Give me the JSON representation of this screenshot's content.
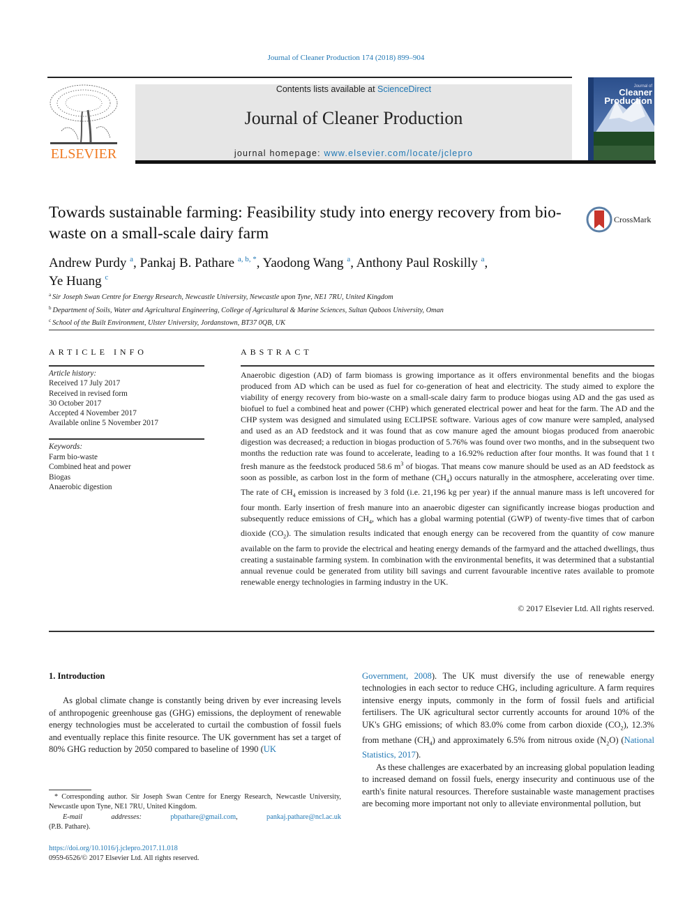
{
  "running_head": "Journal of Cleaner Production 174 (2018) 899–904",
  "publisher": {
    "name": "ELSEVIER",
    "logo_icon": "elsevier-tree-logo",
    "color": "#f07a22"
  },
  "banner": {
    "contents_prefix": "Contents lists available at ",
    "contents_link": "ScienceDirect",
    "journal_title": "Journal of Cleaner Production",
    "homepage_prefix": "journal homepage: ",
    "homepage_link": "www.elsevier.com/locate/jclepro"
  },
  "cover": {
    "line1": "Journal of",
    "line2": "Cleaner",
    "line3": "Production"
  },
  "crossmark": {
    "label": "CrossMark",
    "icon": "crossmark-icon"
  },
  "article": {
    "title": "Towards sustainable farming: Feasibility study into energy recovery from bio-waste on a small-scale dairy farm",
    "authors": [
      {
        "name": "Andrew Purdy",
        "sup": "a",
        "sep": ", "
      },
      {
        "name": "Pankaj B. Pathare",
        "sup": "a, b, *",
        "sep": ", "
      },
      {
        "name": "Yaodong Wang",
        "sup": "a",
        "sep": ", "
      },
      {
        "name": "Anthony Paul Roskilly",
        "sup": "a",
        "sep": ","
      },
      {
        "name": "Ye Huang",
        "sup": "c",
        "sep": ""
      }
    ],
    "affiliations": [
      {
        "key": "a",
        "text": "Sir Joseph Swan Centre for Energy Research, Newcastle University, Newcastle upon Tyne, NE1 7RU, United Kingdom"
      },
      {
        "key": "b",
        "text": "Department of Soils, Water and Agricultural Engineering, College of Agricultural & Marine Sciences, Sultan Qaboos University, Oman"
      },
      {
        "key": "c",
        "text": "School of the Built Environment, Ulster University, Jordanstown, BT37 0QB, UK"
      }
    ]
  },
  "article_info": {
    "heading": "ARTICLE INFO",
    "history_label": "Article history:",
    "history": [
      "Received 17 July 2017",
      "Received in revised form",
      "30 October 2017",
      "Accepted 4 November 2017",
      "Available online 5 November 2017"
    ],
    "keywords_label": "Keywords:",
    "keywords": [
      "Farm bio-waste",
      "Combined heat and power",
      "Biogas",
      "Anaerobic digestion"
    ]
  },
  "abstract": {
    "heading": "ABSTRACT",
    "p1": "Anaerobic digestion (AD) of farm biomass is growing importance as it offers environmental benefits and the biogas produced from AD which can be used as fuel for co-generation of heat and electricity. The study aimed to explore the viability of energy recovery from bio-waste on a small-scale dairy farm to produce biogas using AD and the gas used as biofuel to fuel a combined heat and power (CHP) which generated electrical power and heat for the farm. The AD and the CHP system was designed and simulated using ECLIPSE software. Various ages of cow manure were sampled, analysed and used as an AD feedstock and it was found that as cow manure aged the amount biogas produced from anaerobic digestion was decreased; a reduction in biogas production of 5.76% was found over two months, and in the subsequent two months the reduction rate was found to accelerate, leading to a 16.92% reduction after four months. It was found that 1 t fresh manure as the feedstock produced 58.6 m",
    "p1_sup": "3",
    "p2": " of biogas. That means cow manure should be used as an AD feedstock as soon as possible, as carbon lost in the form of methane (CH",
    "sub_4": "4",
    "sub_2": "2",
    "p3": ") occurs naturally in the atmosphere, accelerating over time. The rate of CH",
    "p4": " emission is increased by 3 fold (i.e. 21,196 kg per year) if the annual manure mass is left uncovered for four month. Early insertion of fresh manure into an anaerobic digester can significantly increase biogas production and subsequently reduce emissions of CH",
    "p5": ", which has a global warming potential (GWP) of twenty-five times that of carbon dioxide (CO",
    "p6": "). The simulation results indicated that enough energy can be recovered from the quantity of cow manure available on the farm to provide the electrical and heating energy demands of the farmyard and the attached dwellings, thus creating a sustainable farming system. In combination with the environmental benefits, it was determined that a substantial annual revenue could be generated from utility bill savings and current favourable incentive rates available to promote renewable energy technologies in farming industry in the UK.",
    "copyright": "© 2017 Elsevier Ltd. All rights reserved."
  },
  "introduction": {
    "heading": "1.  Introduction",
    "left_p1_a": "As global climate change is constantly being driven by ever increasing levels of anthropogenic greenhouse gas (GHG) emissions, the deployment of renewable energy technologies must be accelerated to curtail the combustion of fossil fuels and eventually replace this finite resource. The UK government has set a target of 80% GHG reduction by 2050 compared to baseline of 1990 (",
    "left_cite": "UK",
    "right_cite1": "Government, 2008",
    "right_p1_a": "). The UK must diversify the use of renewable energy technologies in each sector to reduce CHG, including agriculture. A farm requires intensive energy inputs, commonly in the form of fossil fuels and artificial fertilisers. The UK agricultural sector currently accounts for around 10% of the UK's GHG emissions; of which 83.0% come from carbon dioxide (CO",
    "right_p1_b": "), 12.3% from methane (CH",
    "right_p1_c": ") and approximately 6.5% from nitrous oxide (N",
    "right_p1_d": "O) (",
    "right_cite2": "National Statistics, 2017",
    "right_p1_e": ").",
    "right_p2": "As these challenges are exacerbated by an increasing global population leading to increased demand on fossil fuels, energy insecurity and continuous use of the earth's finite natural resources. Therefore sustainable waste management practises are becoming more important not only to alleviate environmental pollution, but"
  },
  "footnote": {
    "corresponding": "* Corresponding author. Sir Joseph Swan Centre for Energy Research, Newcastle University, Newcastle upon Tyne, NE1 7RU, United Kingdom.",
    "email_label": "E-mail addresses:",
    "email1": "pbpathare@gmail.com",
    "email2": "pankaj.pathare@ncl.ac.uk",
    "email_owner": "(P.B. Pathare).",
    "doi": "https://doi.org/10.1016/j.jclepro.2017.11.018",
    "issn_copyright": "0959-6526/© 2017 Elsevier Ltd. All rights reserved."
  }
}
